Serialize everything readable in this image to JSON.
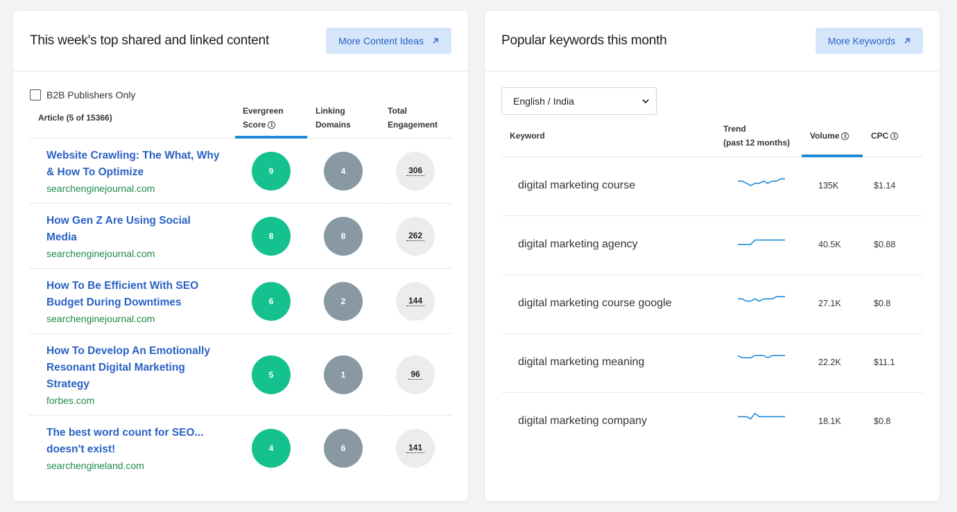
{
  "content_card": {
    "title": "This week's top shared and linked content",
    "more_button": "More Content Ideas",
    "b2b_label": "B2B Publishers Only",
    "columns": {
      "article": "Article (5 of 15366)",
      "evergreen_1": "Evergreen",
      "evergreen_2": "Score",
      "linking_1": "Linking",
      "linking_2": "Domains",
      "total_1": "Total",
      "total_2": "Engagement"
    },
    "articles": [
      {
        "title_1": "Website Crawling: The What, Why",
        "title_2": "& How To Optimize",
        "title_3": "",
        "domain": "searchenginejournal.com",
        "evergreen": "9",
        "linking": "4",
        "engagement": "306"
      },
      {
        "title_1": "How Gen Z Are Using Social",
        "title_2": "Media",
        "title_3": "",
        "domain": "searchenginejournal.com",
        "evergreen": "8",
        "linking": "8",
        "engagement": "262"
      },
      {
        "title_1": "How To Be Efficient With SEO",
        "title_2": "Budget During Downtimes",
        "title_3": "",
        "domain": "searchenginejournal.com",
        "evergreen": "6",
        "linking": "2",
        "engagement": "144"
      },
      {
        "title_1": "How To Develop An Emotionally",
        "title_2": "Resonant Digital Marketing",
        "title_3": "Strategy",
        "domain": "forbes.com",
        "evergreen": "5",
        "linking": "1",
        "engagement": "96"
      },
      {
        "title_1": "The best word count for SEO...",
        "title_2": "doesn't exist!",
        "title_3": "",
        "domain": "searchengineland.com",
        "evergreen": "4",
        "linking": "6",
        "engagement": "141"
      }
    ]
  },
  "keywords_card": {
    "title": "Popular keywords this month",
    "more_button": "More Keywords",
    "language_select": "English / India",
    "columns": {
      "keyword": "Keyword",
      "trend_1": "Trend",
      "trend_2": "(past 12 months)",
      "volume": "Volume",
      "cpc": "CPC"
    },
    "keywords": [
      {
        "keyword": "digital marketing course",
        "volume": "135K",
        "cpc": "$1.14",
        "trend": [
          6,
          6,
          4,
          2,
          4,
          4,
          6,
          4,
          6,
          6,
          8,
          8
        ]
      },
      {
        "keyword": "digital marketing agency",
        "volume": "40.5K",
        "cpc": "$0.88",
        "trend": [
          2,
          2,
          2,
          2,
          6,
          6,
          6,
          6,
          6,
          6,
          6,
          6
        ]
      },
      {
        "keyword": "digital marketing course google",
        "volume": "27.1K",
        "cpc": "$0.8",
        "trend": [
          6,
          6,
          4,
          4,
          6,
          4,
          6,
          6,
          6,
          8,
          8,
          8
        ]
      },
      {
        "keyword": "digital marketing meaning",
        "volume": "22.2K",
        "cpc": "$11.1",
        "trend": [
          8,
          6,
          6,
          6,
          8,
          8,
          8,
          6,
          8,
          8,
          8,
          8
        ]
      },
      {
        "keyword": "digital marketing company",
        "volume": "18.1K",
        "cpc": "$0.8",
        "trend": [
          6,
          6,
          6,
          4,
          9,
          6,
          6,
          6,
          6,
          6,
          6,
          6
        ]
      }
    ],
    "trend_color": "#1e8ad6"
  },
  "colors": {
    "accent": "#2961c4",
    "evergreen": "#15c18f",
    "linking": "#8899a3",
    "domain": "#1e8a4a",
    "tab_underline": "#1e8ad6"
  }
}
